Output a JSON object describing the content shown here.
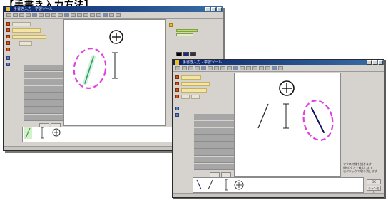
{
  "page": {
    "heading": "【手書き入力方法】"
  },
  "window_before": {
    "title": "手書き入力 - 学習ツール"
  },
  "window_after": {
    "title": "手書き入力 - 学習ツール",
    "help_text_lines": [
      "マウスで線を描きます",
      "OKボタンで確定します",
      "右クリックで取り消します"
    ],
    "ok_label": "OK",
    "cancel_label": "キャンセル"
  },
  "colors": {
    "highlight_circle": "#e040e0",
    "title_bar": "#0a246a",
    "stroke_green": "#2aa070",
    "stroke_blue": "#101060",
    "panel": "#d6d3ce"
  },
  "icons": {
    "plus_circle": "plus-circle-icon",
    "highlight": "dashed-highlight-circle"
  }
}
